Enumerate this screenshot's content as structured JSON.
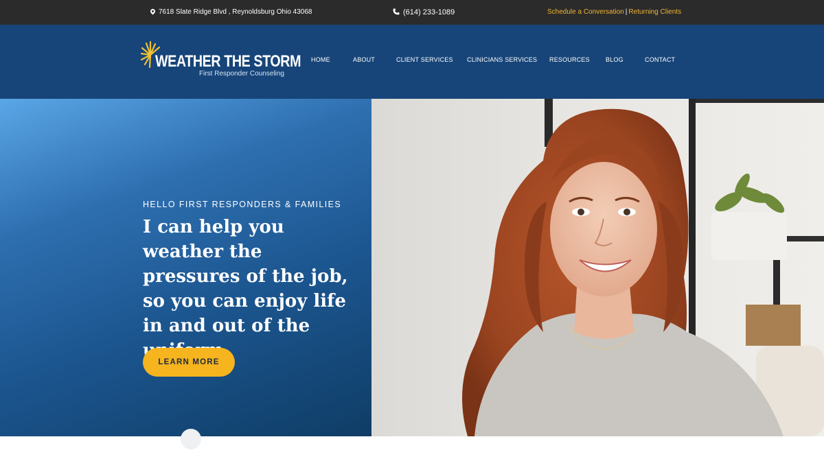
{
  "topbar": {
    "address": "7618 Slate Ridge Blvd , Reynoldsburg Ohio 43068",
    "phone": "(614) 233-1089",
    "schedule_link": "Schedule a Conversation",
    "separator": "|",
    "returning_link": "Returning Clients",
    "icons": {
      "address": "map-pin-icon",
      "phone": "phone-icon"
    }
  },
  "header": {
    "logo_name": "WEATHER THE STORM",
    "logo_tagline": "First Responder Counseling",
    "nav": [
      "HOME",
      "ABOUT",
      "CLIENT SERVICES",
      "CLINICIANS SERVICES",
      "RESOURCES",
      "BLOG",
      "CONTACT"
    ]
  },
  "hero": {
    "eyebrow": "HELLO FIRST RESPONDERS & FAMILIES",
    "headline": "I can help you weather the pressures of the job, so you can enjoy life in and out of the uniform.",
    "cta_label": "LEARN MORE"
  },
  "colors": {
    "topbar_bg": "#2b2b2b",
    "header_bg": "#174579",
    "accent": "#f6b41f",
    "link_gold": "#f2b632"
  }
}
